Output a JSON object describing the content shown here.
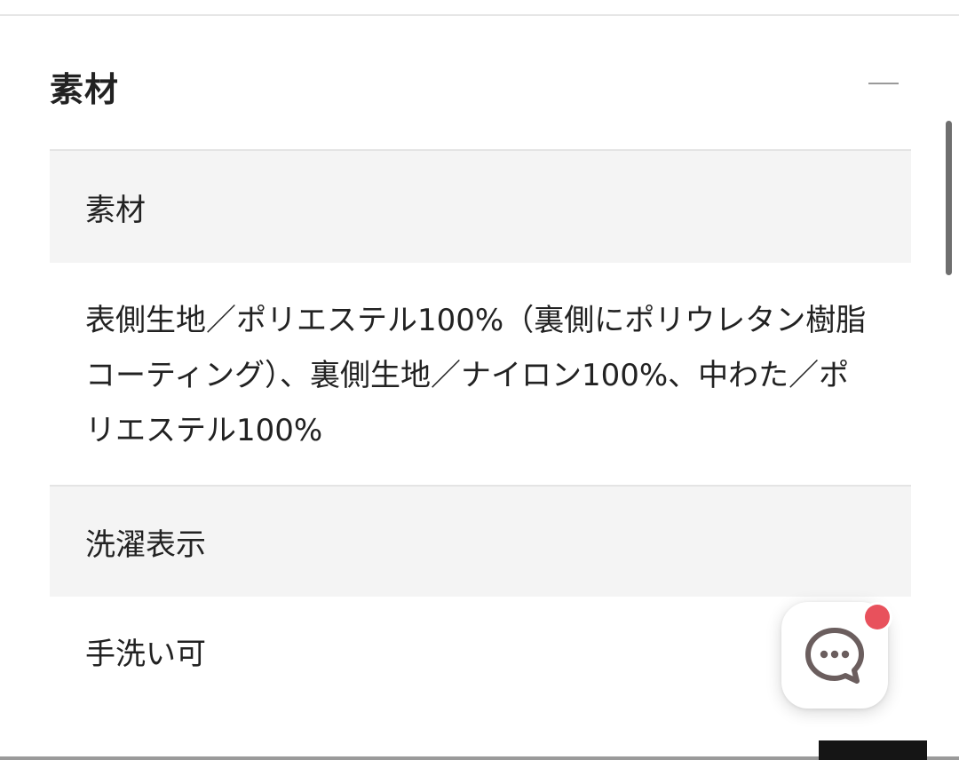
{
  "section": {
    "title": "素材",
    "toggle_symbol": "—"
  },
  "rows": [
    {
      "label": "素材",
      "value": "表側生地／ポリエステル100%（裏側にポリウレタン樹脂コーティング）、裏側生地／ナイロン100%、中わた／ポリエステル100%"
    },
    {
      "label": "洗濯表示",
      "value": "手洗い可"
    }
  ],
  "chat": {
    "icon": "chat-bubble-icon",
    "has_notification": true
  },
  "colors": {
    "header_bg": "#f4f4f4",
    "divider": "#e4e4e4",
    "text": "#222222",
    "notification": "#e8515c",
    "icon": "#6b5e5e"
  }
}
